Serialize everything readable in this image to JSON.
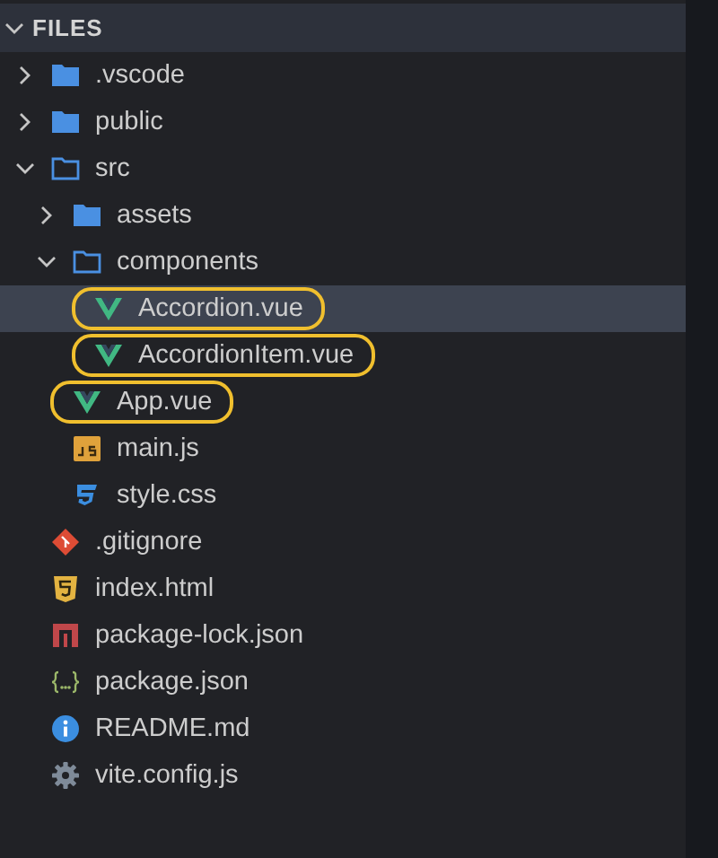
{
  "section": {
    "title": "FILES",
    "expanded": true
  },
  "tree": [
    {
      "name": ".vscode",
      "kind": "folder",
      "expanded": false,
      "selected": false,
      "highlighted": false
    },
    {
      "name": "public",
      "kind": "folder",
      "expanded": false,
      "selected": false,
      "highlighted": false
    },
    {
      "name": "src",
      "kind": "folder",
      "expanded": true,
      "selected": false,
      "highlighted": false,
      "children": [
        {
          "name": "assets",
          "kind": "folder",
          "expanded": false,
          "selected": false,
          "highlighted": false
        },
        {
          "name": "components",
          "kind": "folder",
          "expanded": true,
          "selected": false,
          "highlighted": false,
          "children": [
            {
              "name": "Accordion.vue",
              "kind": "vue",
              "selected": true,
              "highlighted": true
            },
            {
              "name": "AccordionItem.vue",
              "kind": "vue",
              "selected": false,
              "highlighted": true
            }
          ]
        },
        {
          "name": "App.vue",
          "kind": "vue",
          "selected": false,
          "highlighted": true
        },
        {
          "name": "main.js",
          "kind": "js",
          "selected": false,
          "highlighted": false
        },
        {
          "name": "style.css",
          "kind": "css",
          "selected": false,
          "highlighted": false
        }
      ]
    },
    {
      "name": ".gitignore",
      "kind": "git",
      "selected": false,
      "highlighted": false
    },
    {
      "name": "index.html",
      "kind": "html",
      "selected": false,
      "highlighted": false
    },
    {
      "name": "package-lock.json",
      "kind": "npm",
      "selected": false,
      "highlighted": false
    },
    {
      "name": "package.json",
      "kind": "json",
      "selected": false,
      "highlighted": false
    },
    {
      "name": "README.md",
      "kind": "info",
      "selected": false,
      "highlighted": false
    },
    {
      "name": "vite.config.js",
      "kind": "gear",
      "selected": false,
      "highlighted": false
    }
  ]
}
